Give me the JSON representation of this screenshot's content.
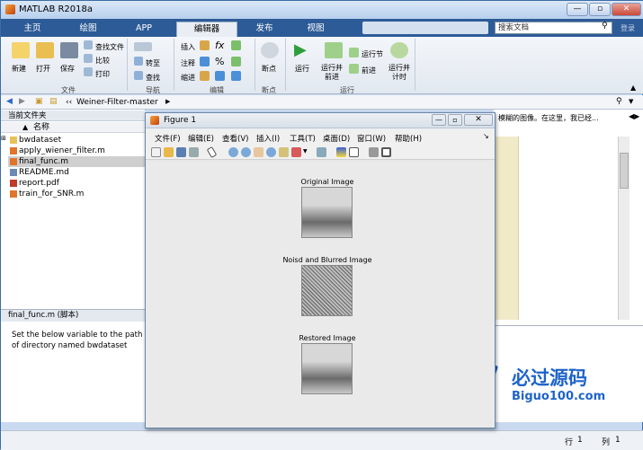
{
  "window": {
    "title": "MATLAB R2018a"
  },
  "tabs": [
    "主页",
    "绘图",
    "APP",
    "编辑器",
    "发布",
    "视图"
  ],
  "search": {
    "placeholder": "搜索文档"
  },
  "user_label": "登录",
  "ribbon": {
    "file_group": {
      "items": [
        "新建",
        "打开",
        "保存"
      ],
      "small": [
        "查找文件",
        "比较",
        "打印"
      ],
      "label": "文件"
    },
    "nav_group": {
      "items": [
        "转至",
        "查找"
      ],
      "label": "导航"
    },
    "edit_group": {
      "items": [
        "插入",
        "注释",
        "缩进"
      ],
      "label": "编辑"
    },
    "bp_group": {
      "items": [
        "断点"
      ],
      "label": "断点"
    },
    "run_group": {
      "items": [
        "运行",
        "运行并\n前进",
        "运行节",
        "前进",
        "运行并\n计时"
      ],
      "label": "运行"
    }
  },
  "address": {
    "path": "Weiner-Filter-master"
  },
  "current_folder": {
    "title": "当前文件夹",
    "column": "名称",
    "files": [
      {
        "name": "bwdataset",
        "type": "folder"
      },
      {
        "name": "apply_wiener_filter.m",
        "type": "m"
      },
      {
        "name": "final_func.m",
        "type": "m",
        "selected": true
      },
      {
        "name": "README.md",
        "type": "md"
      },
      {
        "name": "report.pdf",
        "type": "pdf"
      },
      {
        "name": "train_for_SNR.m",
        "type": "m"
      }
    ]
  },
  "details": {
    "header": "final_func.m  (脚本)",
    "body": "Set the below variable to the path of directory named bwdataset"
  },
  "right_hint": "模糊的图像。在这里，我已经...",
  "statusbar": {
    "row_label": "行",
    "row": "1",
    "col_label": "列",
    "col": "1"
  },
  "figure": {
    "title": "Figure 1",
    "menu": [
      "文件(F)",
      "编辑(E)",
      "查看(V)",
      "插入(I)",
      "工具(T)",
      "桌面(D)",
      "窗口(W)",
      "帮助(H)"
    ],
    "images": [
      {
        "title": "Original Image"
      },
      {
        "title": "Noisd and Blurred Image"
      },
      {
        "title": "Restored Image"
      }
    ]
  },
  "watermark": {
    "line1": "必过源码",
    "line2": "Biguo100.com"
  }
}
